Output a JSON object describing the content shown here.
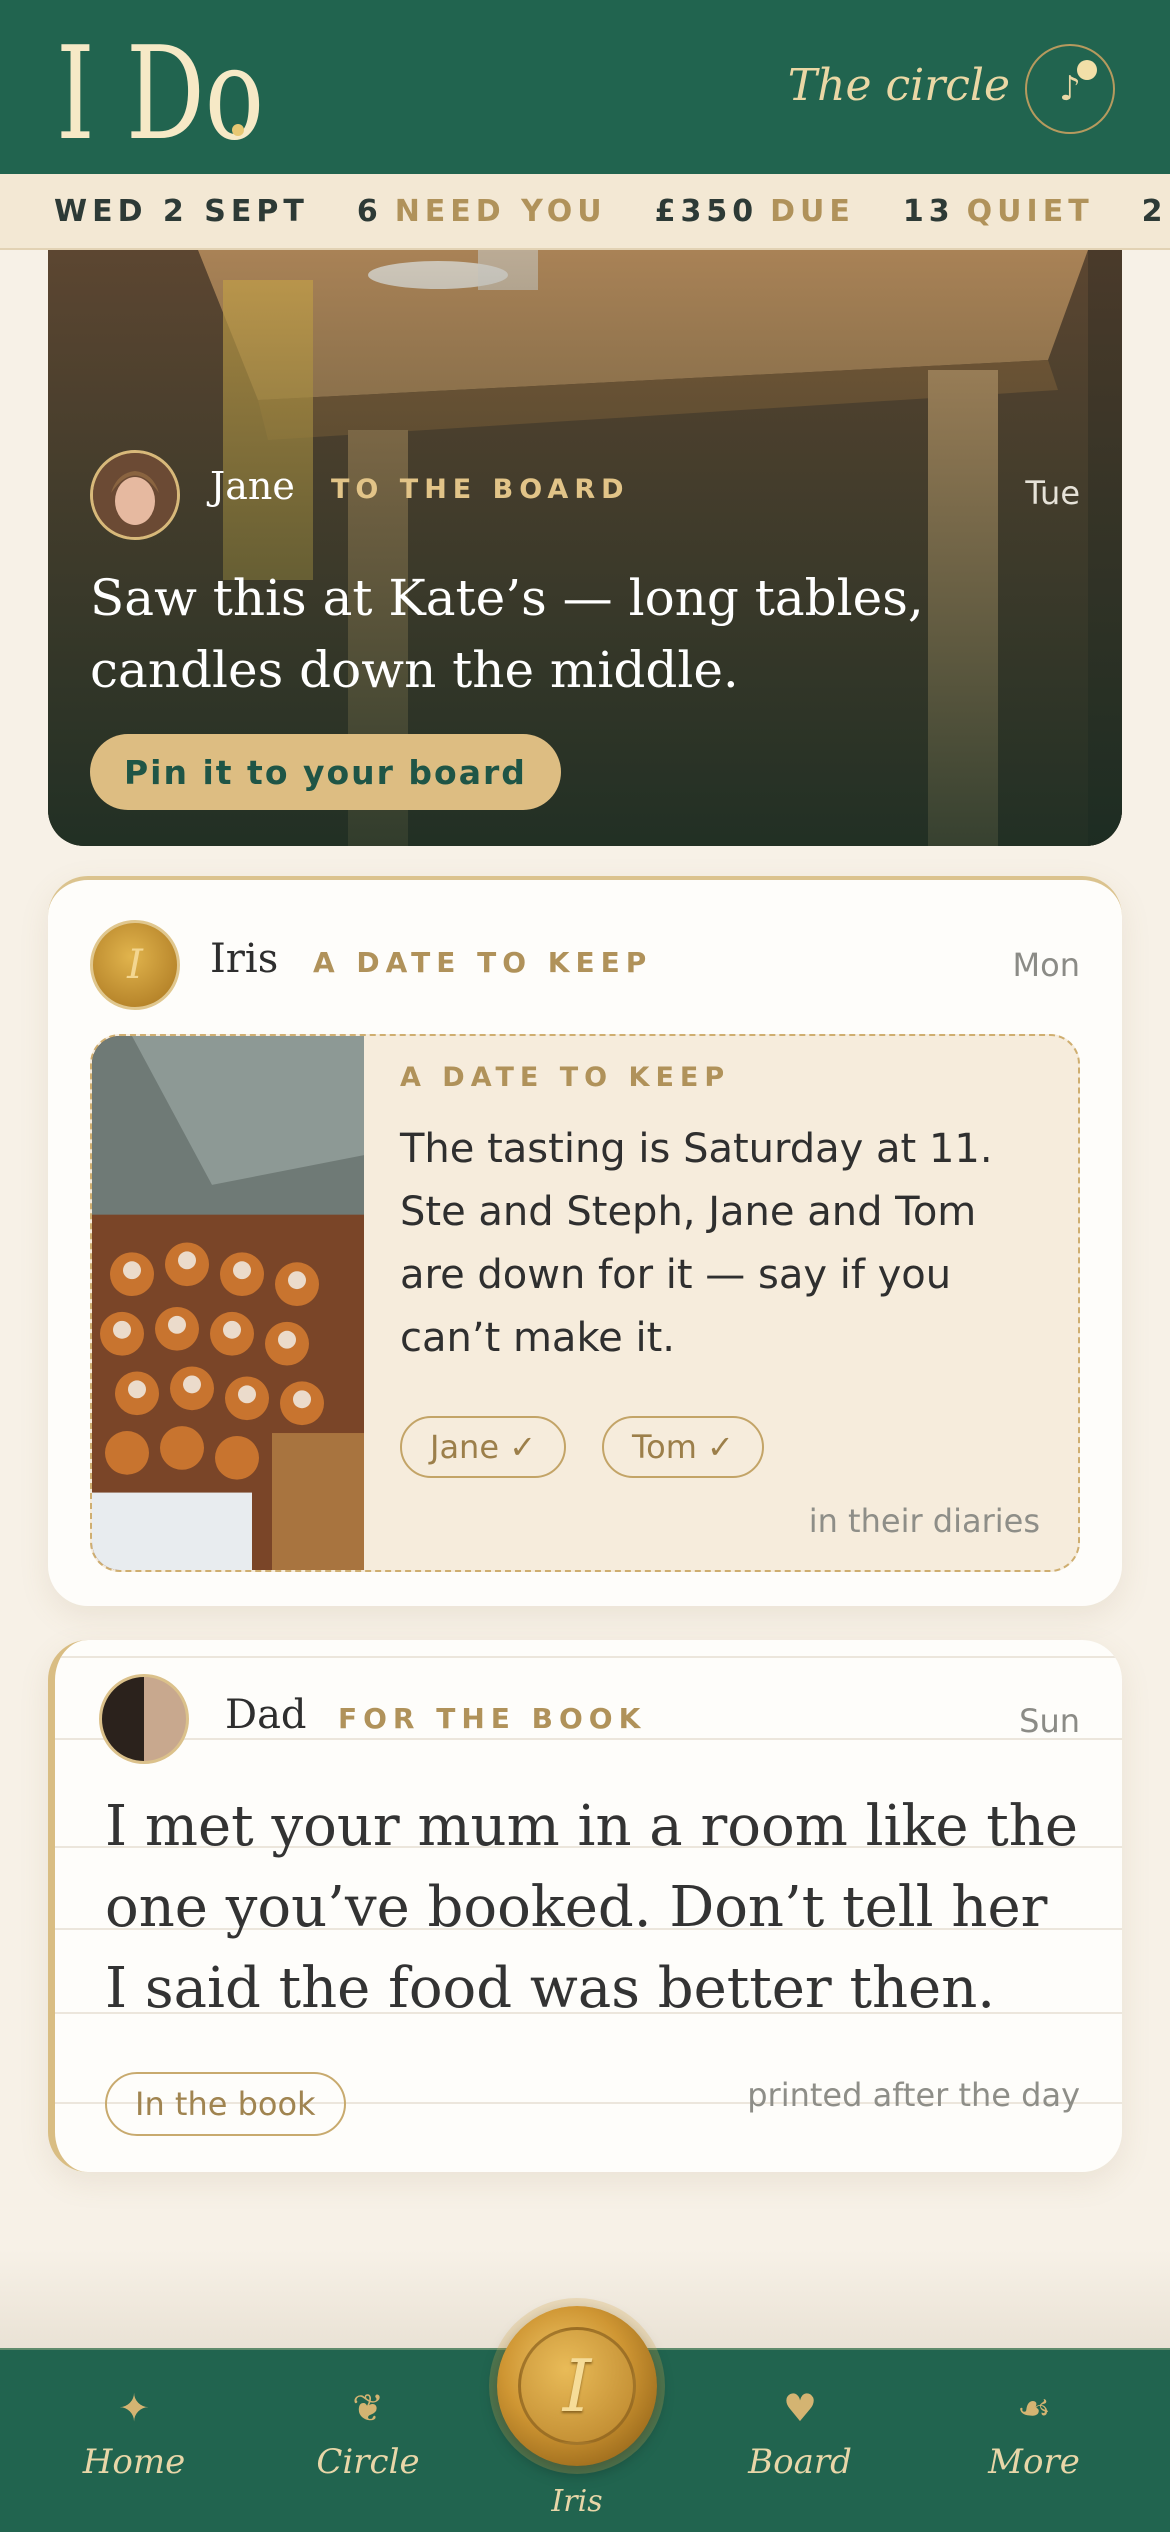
{
  "header": {
    "logo_text": "I Do",
    "circle_link": "The circle",
    "music_icon": "music-note-icon"
  },
  "ticker": {
    "date": "WED 2 SEPT",
    "need_count": "6",
    "need_label": "NEED YOU",
    "due_amount": "£350",
    "due_label": "DUE",
    "quiet_count": "13",
    "quiet_label": "QUIET",
    "next_fragment": "2"
  },
  "cards": [
    {
      "author": "Jane",
      "tag": "TO THE BOARD",
      "day": "Tue",
      "text": "Saw this at Kate’s — long tables, candles down the middle.",
      "action": "Pin it to your board"
    },
    {
      "author": "Iris",
      "tag": "A DATE TO KEEP",
      "day": "Mon",
      "box": {
        "kicker": "A DATE TO KEEP",
        "text": "The tasting is Saturday at 11. Ste and Steph, Jane and Tom are down for it — say if you can’t make it.",
        "chips": [
          "Jane ✓",
          "Tom ✓"
        ],
        "footer": "in their diaries"
      }
    },
    {
      "author": "Dad",
      "tag": "FOR THE BOOK",
      "day": "Sun",
      "text": "I met your mum in a room like the one you’ve booked. Don’t tell her I said the food was better then.",
      "chip": "In the book",
      "footer": "printed after the day"
    }
  ],
  "tabbar": {
    "items": [
      {
        "label": "Home",
        "icon": "sparkle-icon"
      },
      {
        "label": "Circle",
        "icon": "flourish-icon"
      },
      {
        "label": "Iris",
        "icon": "wax-seal-icon",
        "seal_letter": "I"
      },
      {
        "label": "Board",
        "icon": "heart-icon"
      },
      {
        "label": "More",
        "icon": "ornament-icon"
      }
    ]
  },
  "colors": {
    "brand_green": "#21644f",
    "gold": "#b0925a",
    "cream": "#f7f1e7"
  }
}
